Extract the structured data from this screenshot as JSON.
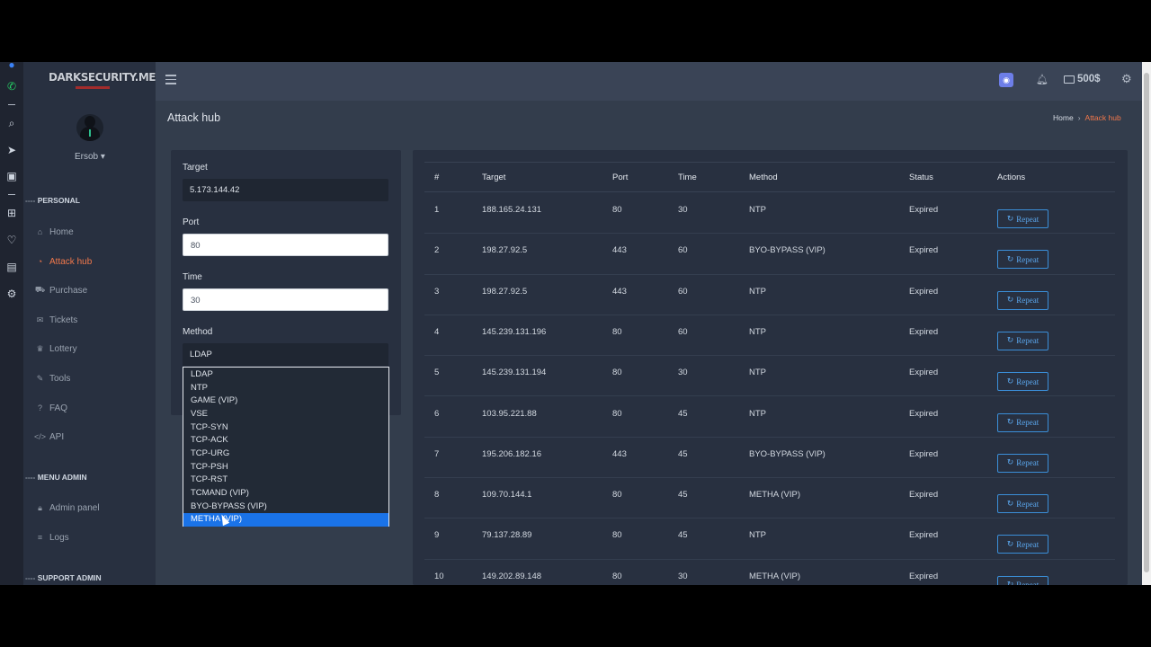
{
  "brand": {
    "logo_text": "DARKSECURITY.ME"
  },
  "user": {
    "name": "Ersob"
  },
  "sidebar": {
    "section_personal": "PERSONAL",
    "section_menu_admin": "MENU ADMIN",
    "section_support_admin": "SUPPORT ADMIN",
    "items": [
      {
        "label": "Home",
        "icon": "home-icon"
      },
      {
        "label": "Attack hub",
        "icon": "gauge-icon",
        "active": true
      },
      {
        "label": "Purchase",
        "icon": "cart-icon"
      },
      {
        "label": "Tickets",
        "icon": "envelope-icon"
      },
      {
        "label": "Lottery",
        "icon": "trophy-icon"
      },
      {
        "label": "Tools",
        "icon": "wrench-icon"
      },
      {
        "label": "FAQ",
        "icon": "question-icon"
      },
      {
        "label": "API",
        "icon": "code-icon"
      }
    ],
    "admin_items": [
      {
        "label": "Admin panel",
        "icon": "lock-icon"
      },
      {
        "label": "Logs",
        "icon": "list-icon"
      }
    ]
  },
  "topbar": {
    "balance": "500$"
  },
  "page": {
    "title": "Attack hub",
    "breadcrumb_home": "Home",
    "breadcrumb_current": "Attack hub"
  },
  "form": {
    "target_label": "Target",
    "target_value": "5.173.144.42",
    "port_label": "Port",
    "port_value": "80",
    "time_label": "Time",
    "time_value": "30",
    "method_label": "Method",
    "method_value": "LDAP",
    "method_options": [
      "LDAP",
      "NTP",
      "GAME (VIP)",
      "VSE",
      "TCP-SYN",
      "TCP-ACK",
      "TCP-URG",
      "TCP-PSH",
      "TCP-RST",
      "TCMAND (VIP)",
      "BYO-BYPASS (VIP)",
      "METHA (VIP)"
    ],
    "method_highlighted": "METHA (VIP)"
  },
  "table": {
    "headers": [
      "#",
      "Target",
      "Port",
      "Time",
      "Method",
      "Status",
      "Actions"
    ],
    "repeat_label": "Repeat",
    "rows": [
      {
        "n": "1",
        "target": "188.165.24.131",
        "port": "80",
        "time": "30",
        "method": "NTP",
        "status": "Expired"
      },
      {
        "n": "2",
        "target": "198.27.92.5",
        "port": "443",
        "time": "60",
        "method": "BYO-BYPASS (VIP)",
        "status": "Expired"
      },
      {
        "n": "3",
        "target": "198.27.92.5",
        "port": "443",
        "time": "60",
        "method": "NTP",
        "status": "Expired"
      },
      {
        "n": "4",
        "target": "145.239.131.196",
        "port": "80",
        "time": "60",
        "method": "NTP",
        "status": "Expired"
      },
      {
        "n": "5",
        "target": "145.239.131.194",
        "port": "80",
        "time": "30",
        "method": "NTP",
        "status": "Expired"
      },
      {
        "n": "6",
        "target": "103.95.221.88",
        "port": "80",
        "time": "45",
        "method": "NTP",
        "status": "Expired"
      },
      {
        "n": "7",
        "target": "195.206.182.16",
        "port": "443",
        "time": "45",
        "method": "BYO-BYPASS (VIP)",
        "status": "Expired"
      },
      {
        "n": "8",
        "target": "109.70.144.1",
        "port": "80",
        "time": "45",
        "method": "METHA (VIP)",
        "status": "Expired"
      },
      {
        "n": "9",
        "target": "79.137.28.89",
        "port": "80",
        "time": "45",
        "method": "NTP",
        "status": "Expired"
      },
      {
        "n": "10",
        "target": "149.202.89.148",
        "port": "80",
        "time": "30",
        "method": "METHA (VIP)",
        "status": "Expired"
      }
    ]
  }
}
